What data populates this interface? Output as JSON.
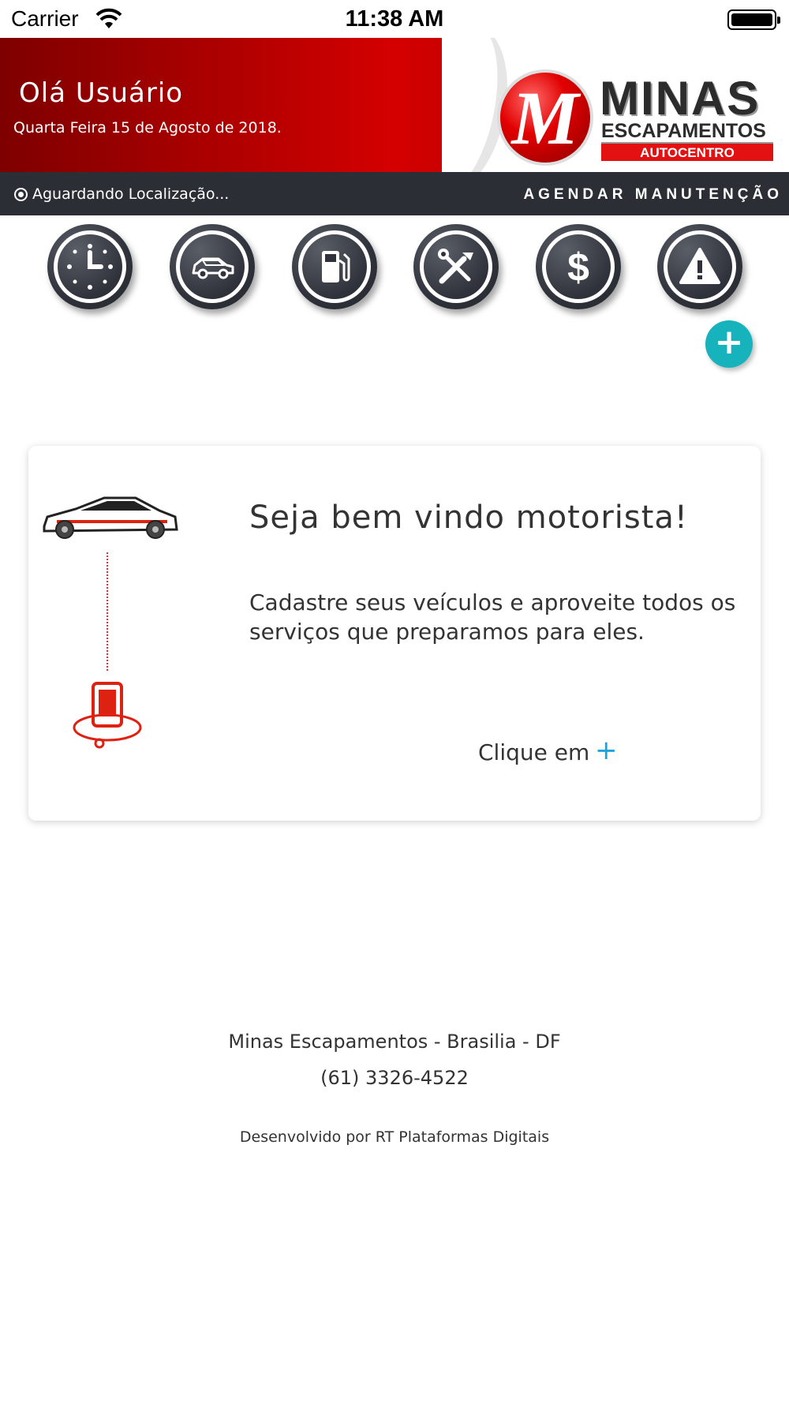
{
  "status_bar": {
    "carrier": "Carrier",
    "time": "11:38 AM",
    "battery_level": 1.0
  },
  "header": {
    "greeting": "Olá Usuário",
    "date": "Quarta Feira 15 de Agosto de 2018.",
    "logo": {
      "mark": "M",
      "title": "MINAS",
      "subtitle": "ESCAPAMENTOS",
      "band": "AUTOCENTRO"
    },
    "colors": {
      "primary": "#c40000",
      "dark": "#2b2e35"
    }
  },
  "location_bar": {
    "status_text": "Aguardando Localização...",
    "schedule_label": "AGENDAR MANUTENÇÃO"
  },
  "shortcuts": [
    {
      "icon": "clock-icon"
    },
    {
      "icon": "car-icon"
    },
    {
      "icon": "fuel-pump-icon"
    },
    {
      "icon": "tools-icon"
    },
    {
      "icon": "dollar-icon"
    },
    {
      "icon": "warning-icon"
    }
  ],
  "fab": {
    "icon": "plus-icon",
    "label": "+",
    "color": "#17b3bd"
  },
  "welcome_card": {
    "title": "Seja bem vindo motorista!",
    "text": "Cadastre seus veículos e aproveite todos os serviços que preparamos para eles.",
    "cta": "Clique em",
    "cta_icon": "+",
    "cta_color": "#1aa3dc"
  },
  "footer": {
    "company": "Minas Escapamentos - Brasilia - DF",
    "phone": "(61) 3326-4522",
    "credit": "Desenvolvido por RT Plataformas Digitais"
  }
}
